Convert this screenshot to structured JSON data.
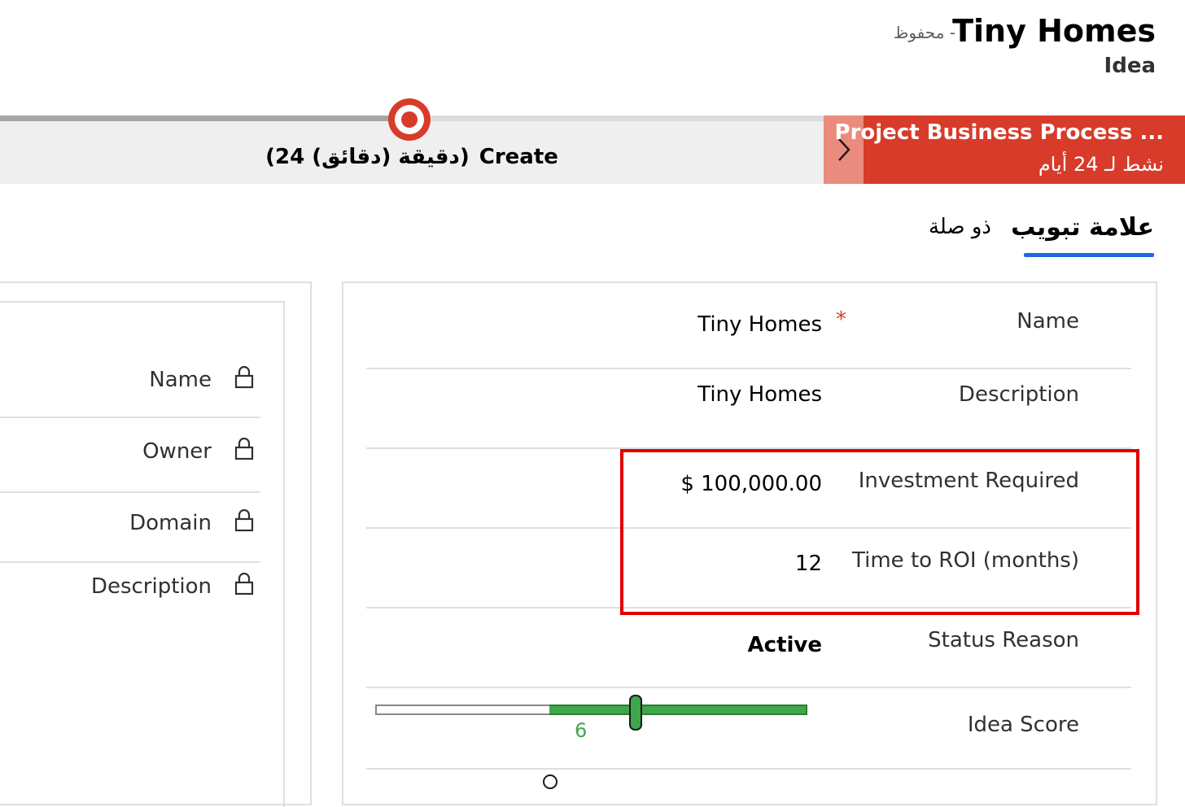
{
  "header": {
    "record_title": "Tiny Homes",
    "saved_status": "محفوظ -",
    "entity_type": "Idea"
  },
  "bpf": {
    "stage_name": "Create",
    "stage_duration": "(24 دقيقة (دقائق))",
    "process_name": "Project Business Process ...",
    "process_active": "نشط لـ 24 أيام"
  },
  "tabs": [
    {
      "label": "علامة تبويب",
      "selected": true
    },
    {
      "label": "ذو صلة",
      "selected": false
    }
  ],
  "locked_fields": [
    {
      "label": "Name"
    },
    {
      "label": "Owner"
    },
    {
      "label": "Domain"
    },
    {
      "label": "Description"
    }
  ],
  "form": {
    "name": {
      "label": "Name",
      "value": "Tiny Homes",
      "required_mark": "*"
    },
    "description": {
      "label": "Description",
      "value": "Tiny Homes"
    },
    "investment": {
      "label": "Investment Required",
      "value": "$ 100,000.00"
    },
    "roi": {
      "label": "Time to ROI (months)",
      "value": "12"
    },
    "status": {
      "label": "Status Reason",
      "value": "Active"
    },
    "score": {
      "label": "Idea Score",
      "value": "6",
      "min": 1,
      "max": 10
    }
  },
  "colors": {
    "accent_blue": "#2266e3",
    "bpf_red": "#d83b2a",
    "slider_green": "#3da74a",
    "highlight_red": "#e00000"
  }
}
